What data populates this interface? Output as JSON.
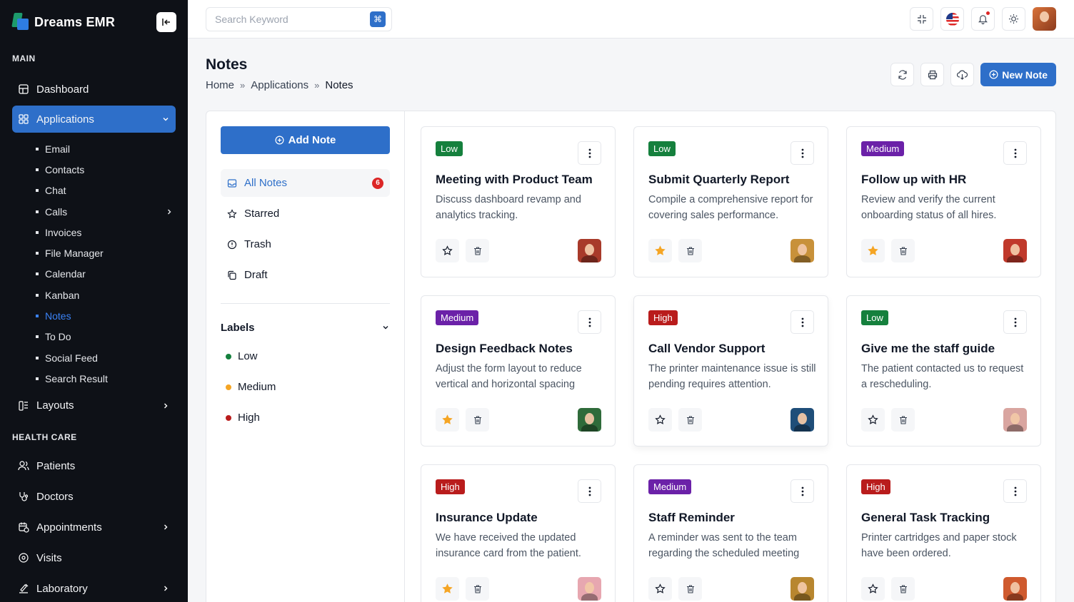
{
  "brand": {
    "name": "Dreams EMR"
  },
  "sidebar": {
    "main_title": "MAIN",
    "dashboard": "Dashboard",
    "applications": "Applications",
    "apps": [
      "Email",
      "Contacts",
      "Chat",
      "Calls",
      "Invoices",
      "File Manager",
      "Calendar",
      "Kanban",
      "Notes",
      "To Do",
      "Social Feed",
      "Search Result"
    ],
    "active_app": "Notes",
    "layouts": "Layouts",
    "health_title": "HEALTH CARE",
    "patients": "Patients",
    "doctors": "Doctors",
    "appointments": "Appointments",
    "visits": "Visits",
    "laboratory": "Laboratory"
  },
  "topbar": {
    "search_placeholder": "Search Keyword",
    "shortcut": "⌘"
  },
  "page": {
    "title": "Notes",
    "breadcrumb": [
      "Home",
      "Applications",
      "Notes"
    ],
    "sep": "»",
    "new_note": "New Note"
  },
  "left": {
    "add_note": "Add Note",
    "folders": {
      "all": "All Notes",
      "all_count": "6",
      "starred": "Starred",
      "trash": "Trash",
      "draft": "Draft"
    },
    "labels_title": "Labels",
    "labels": [
      {
        "name": "Low",
        "color": "#15803d"
      },
      {
        "name": "Medium",
        "color": "#f5a524"
      },
      {
        "name": "High",
        "color": "#b91c1c"
      }
    ]
  },
  "colors": {
    "low": "#15803d",
    "medium": "#6b21a8",
    "high": "#b91c1c",
    "primary": "#2e6fc9",
    "star": "#f5a524"
  },
  "notes": [
    {
      "priority": "Low",
      "title": "Meeting with Product Team",
      "desc": "Discuss dashboard revamp and analytics tracking.",
      "starred": false,
      "avatar": "#a83a2a"
    },
    {
      "priority": "Low",
      "title": "Submit Quarterly Report",
      "desc": "Compile a comprehensive report for covering sales performance.",
      "starred": true,
      "avatar": "#c8913a"
    },
    {
      "priority": "Medium",
      "title": "Follow up with HR",
      "desc": "Review and verify the current onboarding status of all hires.",
      "starred": true,
      "avatar": "#c0392b"
    },
    {
      "priority": "Medium",
      "title": "Design Feedback Notes",
      "desc": "Adjust the form layout to reduce vertical and horizontal spacing",
      "starred": true,
      "avatar": "#2f6b3a"
    },
    {
      "priority": "High",
      "title": "Call Vendor Support",
      "desc": "The printer maintenance issue is still pending requires attention.",
      "starred": false,
      "avatar": "#1f4e79"
    },
    {
      "priority": "Low",
      "title": "Give me the staff guide",
      "desc": "The patient contacted us to request a rescheduling.",
      "starred": false,
      "avatar": "#d9a5a0"
    },
    {
      "priority": "High",
      "title": "Insurance Update",
      "desc": "We have received the updated insurance card from the patient.",
      "starred": true,
      "avatar": "#e7a7b0"
    },
    {
      "priority": "Medium",
      "title": "Staff Reminder",
      "desc": "A reminder was sent to the team regarding the scheduled meeting",
      "starred": false,
      "avatar": "#b8862f"
    },
    {
      "priority": "High",
      "title": "General Task Tracking",
      "desc": "Printer cartridges and paper stock have been ordered.",
      "starred": false,
      "avatar": "#cf5a2e"
    }
  ]
}
